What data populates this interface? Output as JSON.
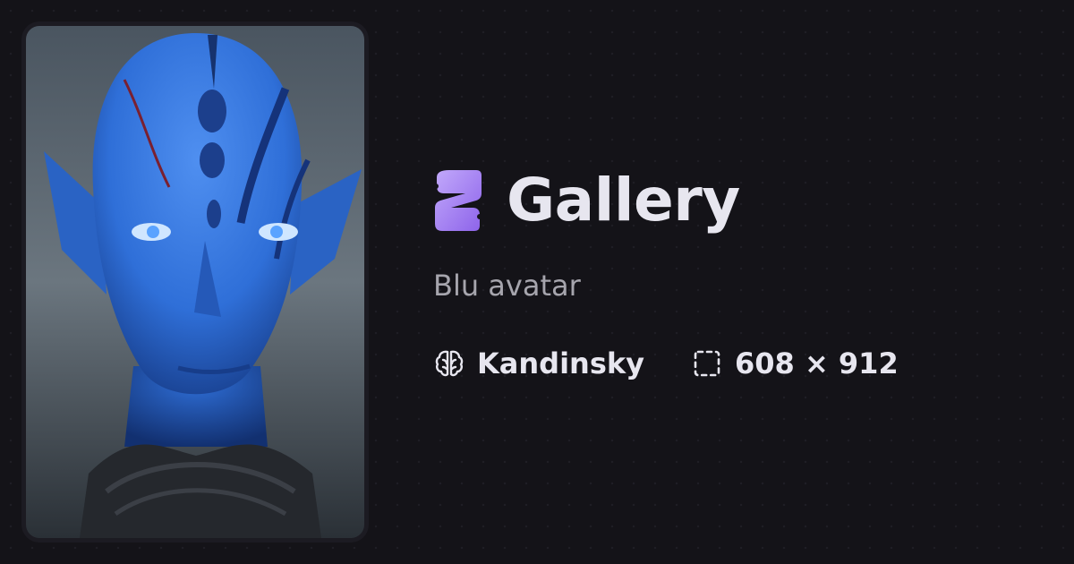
{
  "brand": {
    "title": "Gallery",
    "logo_icon": "gallery-logo-icon",
    "accent_color": "#a98bf2"
  },
  "image": {
    "description_icon": "blue-avatar-portrait"
  },
  "prompt": "Blu avatar",
  "meta": {
    "model": {
      "icon": "brain-icon",
      "label": "Kandinsky"
    },
    "dimensions": {
      "icon": "dashed-frame-icon",
      "label": "608 × 912"
    }
  },
  "colors": {
    "background": "#141318",
    "title": "#e7e6ef",
    "subtitle": "#a6a5ad"
  }
}
